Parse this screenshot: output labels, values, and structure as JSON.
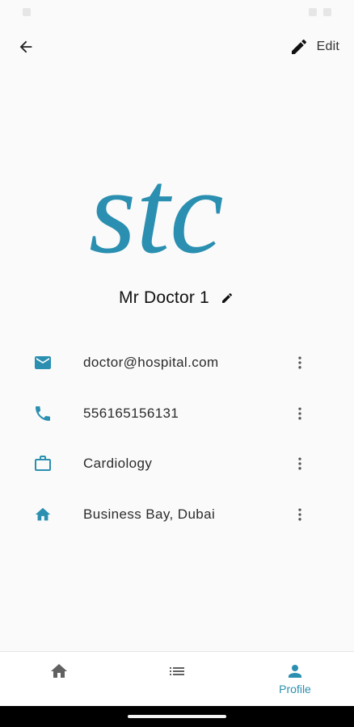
{
  "header": {
    "edit_label": "Edit",
    "back_icon": "arrow-back-icon",
    "edit_icon": "pencil-icon"
  },
  "avatar": {
    "logo_text": "stc",
    "logo_color": "#2a8fb0"
  },
  "profile": {
    "name": "Mr Doctor 1"
  },
  "info_rows": [
    {
      "icon": "mail-icon",
      "value": "doctor@hospital.com"
    },
    {
      "icon": "phone-icon",
      "value": "556165156131"
    },
    {
      "icon": "briefcase-icon",
      "value": "Cardiology"
    },
    {
      "icon": "home-icon",
      "value": "Business Bay, Dubai"
    }
  ],
  "bottom_nav": {
    "items": [
      {
        "icon": "home-icon",
        "label": "",
        "active": false
      },
      {
        "icon": "list-icon",
        "label": "",
        "active": false
      },
      {
        "icon": "person-icon",
        "label": "Profile",
        "active": true
      }
    ]
  },
  "colors": {
    "accent": "#2a8fb0",
    "icon_dark": "#5f5f5f",
    "background": "#fafafa"
  }
}
